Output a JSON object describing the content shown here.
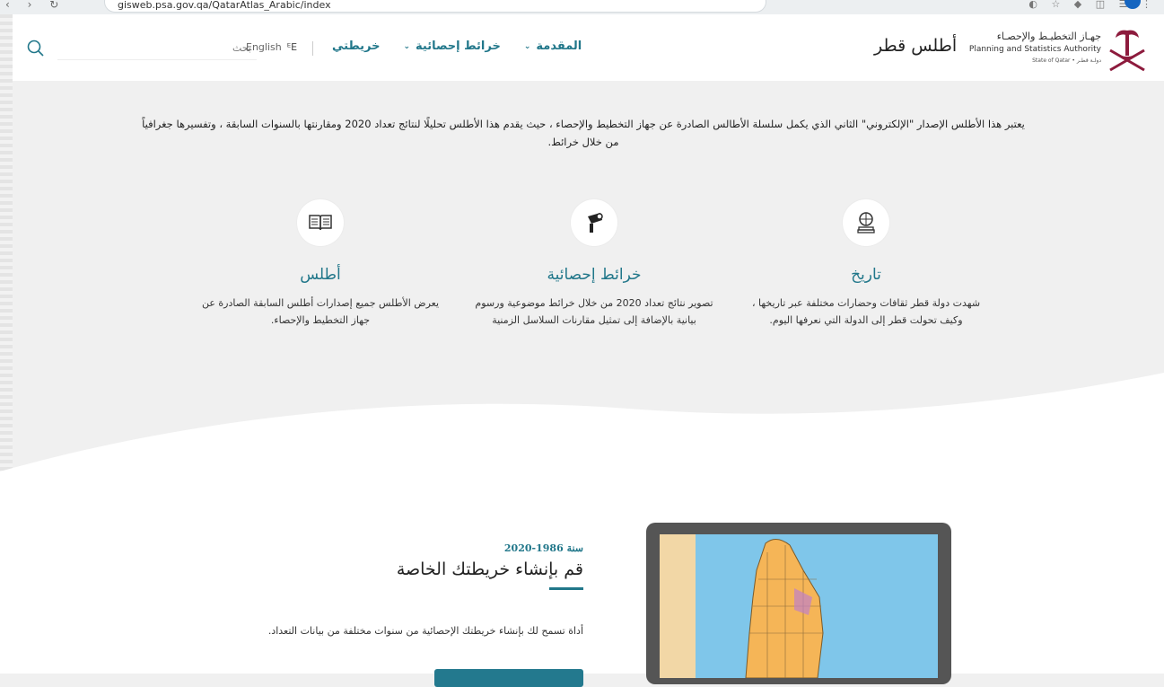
{
  "browser": {
    "url": "gisweb.psa.gov.qa/QatarAtlas_Arabic/index"
  },
  "header": {
    "logo": {
      "arabic_name": "جهـاز التخطيـط والإحصـاء",
      "english_name": "Planning and Statistics Authority",
      "state": "State of Qatar • دولـة قطـر"
    },
    "site_title": "أطلس قطر",
    "menu": [
      {
        "label": "المقدمة",
        "has_dropdown": true
      },
      {
        "label": "خرائط إحصائية",
        "has_dropdown": true
      },
      {
        "label": "خريطتي",
        "has_dropdown": false
      }
    ],
    "language_label": "English",
    "search_placeholder": "بحث"
  },
  "intro": {
    "text": "يعتبر هذا الأطلس الإصدار \"الإلكتروني\" الثاني الذي يكمل سلسلة الأطالس الصادرة عن جهاز التخطيط والإحصاء ، حيث يقدم هذا الأطلس تحليلًا لنتائج تعداد 2020 ومقارنتها بالسنوات السابقة ، وتفسيرها جغرافياً من خلال خرائط."
  },
  "features": [
    {
      "icon": "globe-books-icon",
      "title": "تاريخ",
      "description": "شهدت دولة قطر ثقافات وحضارات مختلفة عبر تاريخها ، وكيف تحولت قطر إلى الدولة التي نعرفها اليوم."
    },
    {
      "icon": "binoculars-icon",
      "title": "خرائط إحصائية",
      "description": "تصوير نتائج تعداد 2020 من خلال خرائط موضوعية ورسوم بيانية بالإضافة إلى تمثيل مقارنات السلاسل الزمنية"
    },
    {
      "icon": "open-book-icon",
      "title": "أطلس",
      "description": "يعرض الأطلس جميع إصدارات أطلس السابقة الصادرة عن جهاز التخطيط والإحصاء."
    }
  ],
  "map_builder": {
    "year_range": "سنة 1986-2020",
    "title": "قم بإنشاء خريطتك الخاصة",
    "description": "أداة تسمح لك بإنشاء خريطتك الإحصائية من سنوات مختلفة من بيانات التعداد."
  },
  "colors": {
    "accent": "#21778a",
    "background": "#f0f0f0",
    "map_land": "#f5b557",
    "map_sea": "#7fc6ea"
  }
}
